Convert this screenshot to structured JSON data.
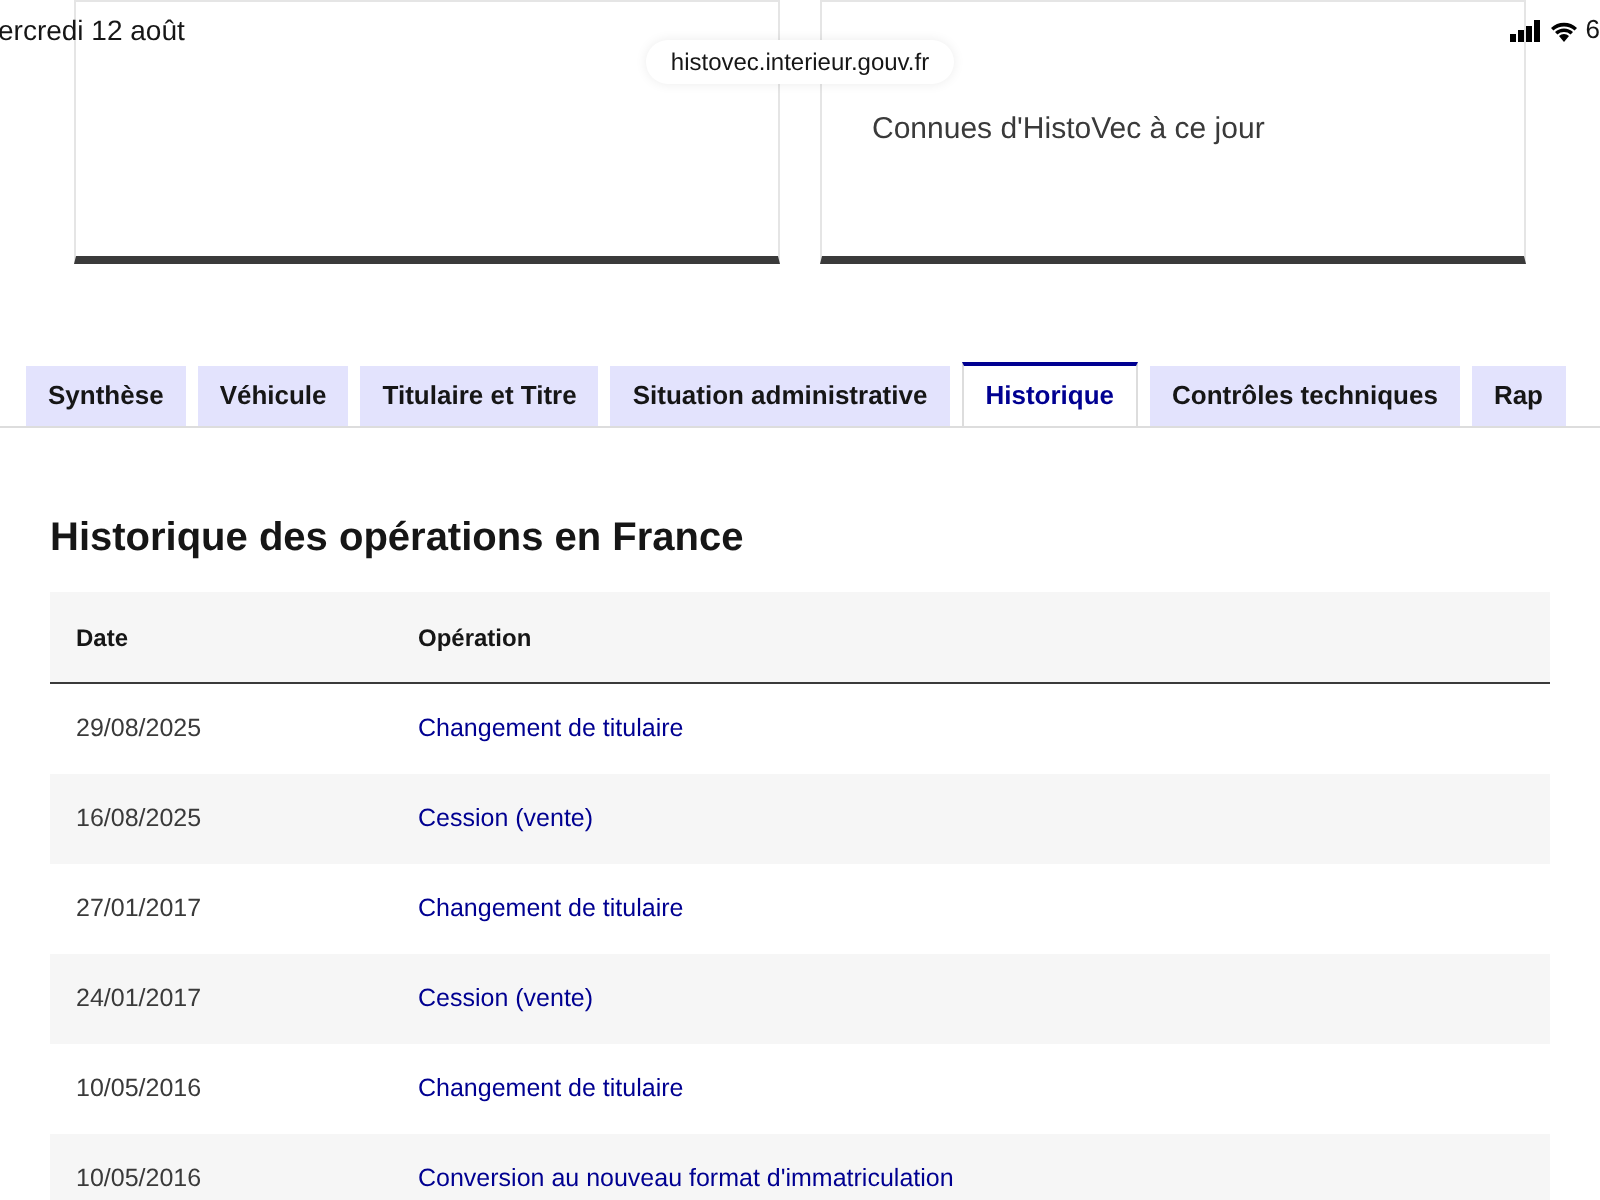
{
  "status_bar": {
    "date": "ercredi 12 août",
    "battery": "6"
  },
  "address_bar": {
    "url": "histovec.interieur.gouv.fr"
  },
  "right_card": {
    "text": "Connues d'HistoVec à ce jour"
  },
  "tabs": [
    {
      "label": "Synthèse",
      "selected": false
    },
    {
      "label": "Véhicule",
      "selected": false
    },
    {
      "label": "Titulaire et Titre",
      "selected": false
    },
    {
      "label": "Situation administrative",
      "selected": false
    },
    {
      "label": "Historique",
      "selected": true
    },
    {
      "label": "Contrôles techniques",
      "selected": false
    },
    {
      "label": "Rap",
      "selected": false
    }
  ],
  "section": {
    "title": "Historique des opérations en France"
  },
  "table": {
    "columns": [
      "Date",
      "Opération"
    ],
    "rows": [
      [
        "29/08/2025",
        "Changement de titulaire"
      ],
      [
        "16/08/2025",
        "Cession (vente)"
      ],
      [
        "27/01/2017",
        "Changement de titulaire"
      ],
      [
        "24/01/2017",
        "Cession (vente)"
      ],
      [
        "10/05/2016",
        "Changement de titulaire"
      ],
      [
        "10/05/2016",
        "Conversion au nouveau format d'immatriculation"
      ]
    ]
  }
}
